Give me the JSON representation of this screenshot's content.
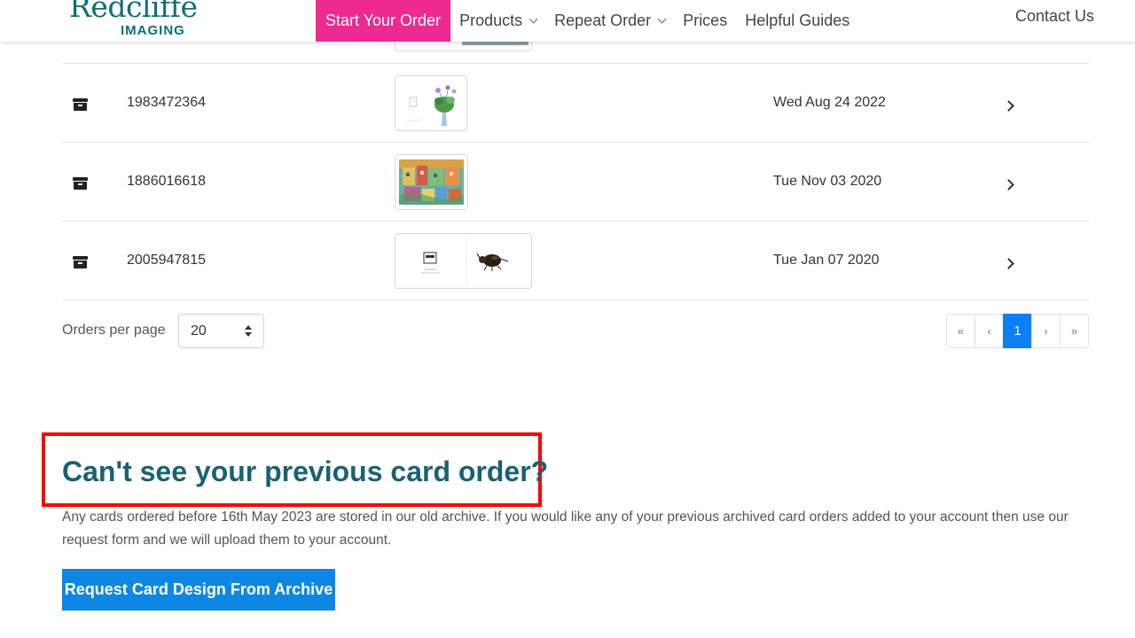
{
  "header": {
    "logo_main": "Redcliffe",
    "logo_sub": "IMAGING",
    "nav": [
      {
        "label": "Start Your Order"
      },
      {
        "label": "Products"
      },
      {
        "label": "Repeat Order"
      },
      {
        "label": "Prices"
      },
      {
        "label": "Helpful Guides"
      }
    ],
    "contact": "Contact Us"
  },
  "orders": {
    "rows": [
      {
        "icon": "archive-icon",
        "order_id": "1983472364",
        "date": "Wed Aug 24 2022",
        "thumbnail": "white card with green plant in vase"
      },
      {
        "icon": "archive-icon",
        "order_id": "1886016618",
        "date": "Tue Nov 03 2020",
        "thumbnail": "colourful painting of houses"
      },
      {
        "icon": "archive-icon",
        "order_id": "2005947815",
        "date": "Tue Jan 07 2020",
        "thumbnail": "white card with beetle illustration"
      }
    ]
  },
  "pagination": {
    "per_page_label": "Orders per page",
    "per_page_value": "20",
    "controls": [
      "«",
      "‹",
      "1",
      "›",
      "»"
    ],
    "current_page": "1"
  },
  "archive": {
    "title": "Can't see your previous card order?",
    "text": "Any cards ordered before 16th May 2023 are stored in our old archive. If you would like any of your previous archived card orders added to your account then use our request form and we will upload them to your account.",
    "button_label": "Request Card Design From Archive"
  },
  "colors": {
    "brand_teal": "#0e6f75",
    "start_order_pink": "#ec2a8f",
    "active_page_blue": "#0d7ff5",
    "button_blue": "#0d87e3",
    "highlight_red": "#ff0000",
    "title_teal": "#1a6270"
  }
}
